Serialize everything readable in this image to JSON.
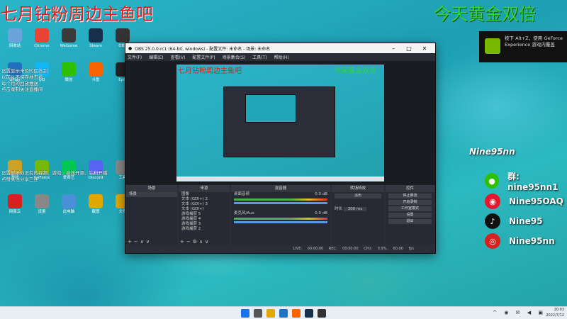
{
  "overlay": {
    "title_red": "七月钻粉周边主鱼吧",
    "title_green": "今天黄金双倍",
    "streamer_handle": "Nine95nn",
    "nvidia_notice": "按下 Alt+Z，使用 GeForce Experience 游戏内覆盖",
    "social": [
      {
        "icon": "wechat-icon",
        "text": "群: nine95nn1",
        "color": "#2dc100"
      },
      {
        "icon": "weibo-icon",
        "text": "Nine95OAQ",
        "color": "#e6162d"
      },
      {
        "icon": "tiktok-icon",
        "text": "Nine95",
        "color": "#111111"
      },
      {
        "icon": "netease-music-icon",
        "text": "Nine95nn",
        "color": "#d8201f"
      }
    ]
  },
  "desktop": {
    "banner_lines": [
      "设置显示未及时回答到",
      "以前从不保存地去看",
      "每个月的回放推送",
      "点击录制关注直播间"
    ],
    "icons": [
      "回收站",
      "Chrome",
      "WeGame",
      "Steam",
      "OBS",
      "UPlay",
      "QQ",
      "微信",
      "斗鱼",
      "Epic",
      "游戏",
      "GeForce",
      "爱奇艺",
      "Discord",
      "工具",
      "网易云",
      "设置",
      "此电脑",
      "截图",
      "文件"
    ],
    "notice_lines": [
      "设置显示你没有的视频、游戏、音效开源、钻粉开播",
      "点赞关注分享三连"
    ]
  },
  "obs": {
    "window_title": "OBS 25.0.0-rc1 (64-bit, windows) - 配置文件: 未命名 - 场景: 未命名",
    "menu": [
      "文件(F)",
      "编辑(E)",
      "查看(V)",
      "配置文件(P)",
      "场景集合(S)",
      "工具(T)",
      "帮助(H)"
    ],
    "panels": {
      "scenes": {
        "title": "场景",
        "items": [
          "场景"
        ]
      },
      "sources": {
        "title": "来源",
        "items": [
          "图像",
          "文本 (GDI+) 2",
          "文本 (GDI+) 3",
          "文本 (GDI+)",
          "游戏捕获 5",
          "游戏捕获 4",
          "游戏捕获 3",
          "游戏捕获 2"
        ]
      },
      "mixer": {
        "title": "混音器",
        "tracks": [
          {
            "name": "桌面音频",
            "db": "0.0 dB"
          },
          {
            "name": "麦克风/Aux",
            "db": "0.0 dB"
          }
        ]
      },
      "transitions": {
        "title": "转场特效",
        "type": "淡出",
        "duration_label": "时长",
        "duration": "300 ms"
      },
      "controls": {
        "title": "控件",
        "buttons": [
          "停止推流",
          "开始录制",
          "工作室模式",
          "设置",
          "退出"
        ]
      }
    },
    "status": "LIVE: 00:00:00  REC: 00:00:00  CPU: 0.9%, 60.00 fps"
  },
  "taskbar": {
    "time": "20:03",
    "date": "2022/7/12"
  }
}
